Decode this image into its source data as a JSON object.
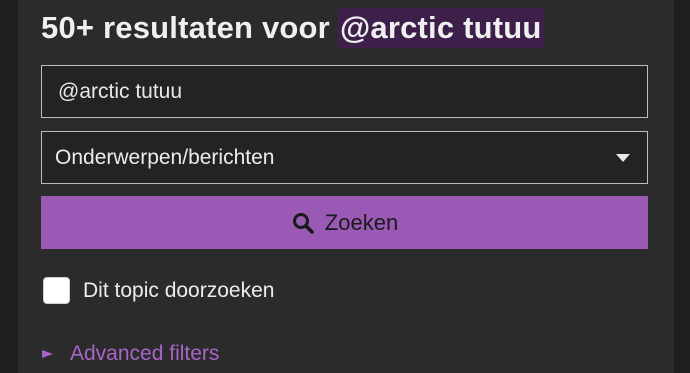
{
  "header": {
    "title_prefix": "50+ resultaten voor",
    "title_query": "@arctic tutuu"
  },
  "search": {
    "value": "@arctic tutuu",
    "placeholder": ""
  },
  "type_select": {
    "selected": "Onderwerpen/berichten"
  },
  "search_button": {
    "label": "Zoeken",
    "icon": "search-icon"
  },
  "topic_checkbox": {
    "label": "Dit topic doorzoeken",
    "checked": false
  },
  "advanced_filters": {
    "label": "Advanced filters",
    "expanded": false
  },
  "colors": {
    "accent": "#9b59b6",
    "link": "#a865c8",
    "background": "#2b2b2b",
    "query_highlight": "#3d1f4a"
  }
}
